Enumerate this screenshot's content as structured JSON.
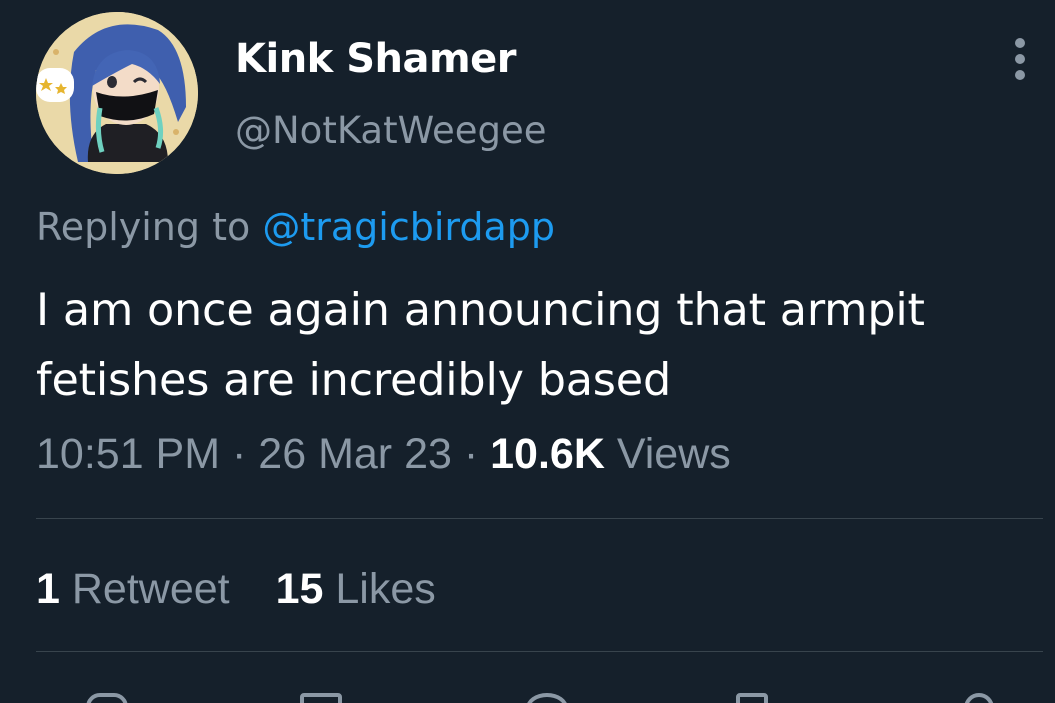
{
  "author": {
    "display_name": "Kink Shamer",
    "handle": "@NotKatWeegee",
    "avatar_icon": "anime-avatar-icon"
  },
  "reply": {
    "prefix": "Replying to",
    "to_handle": "@tragicbirdapp"
  },
  "tweet": {
    "text": "I am once again announcing that armpit fetishes are incredibly based"
  },
  "meta": {
    "time": "10:51 PM",
    "separator": "·",
    "date": "26 Mar 23",
    "views_count": "10.6K",
    "views_label": "Views"
  },
  "stats": {
    "retweets_count": "1",
    "retweets_label": "Retweet",
    "likes_count": "15",
    "likes_label": "Likes"
  },
  "colors": {
    "background": "#15202b",
    "primary_text": "#ffffff",
    "secondary_text": "#8b98a5",
    "link": "#1d9bf0",
    "divider": "#38444d"
  },
  "actions": [
    "reply-icon",
    "retweet-icon",
    "like-icon",
    "bookmark-icon",
    "share-icon"
  ]
}
